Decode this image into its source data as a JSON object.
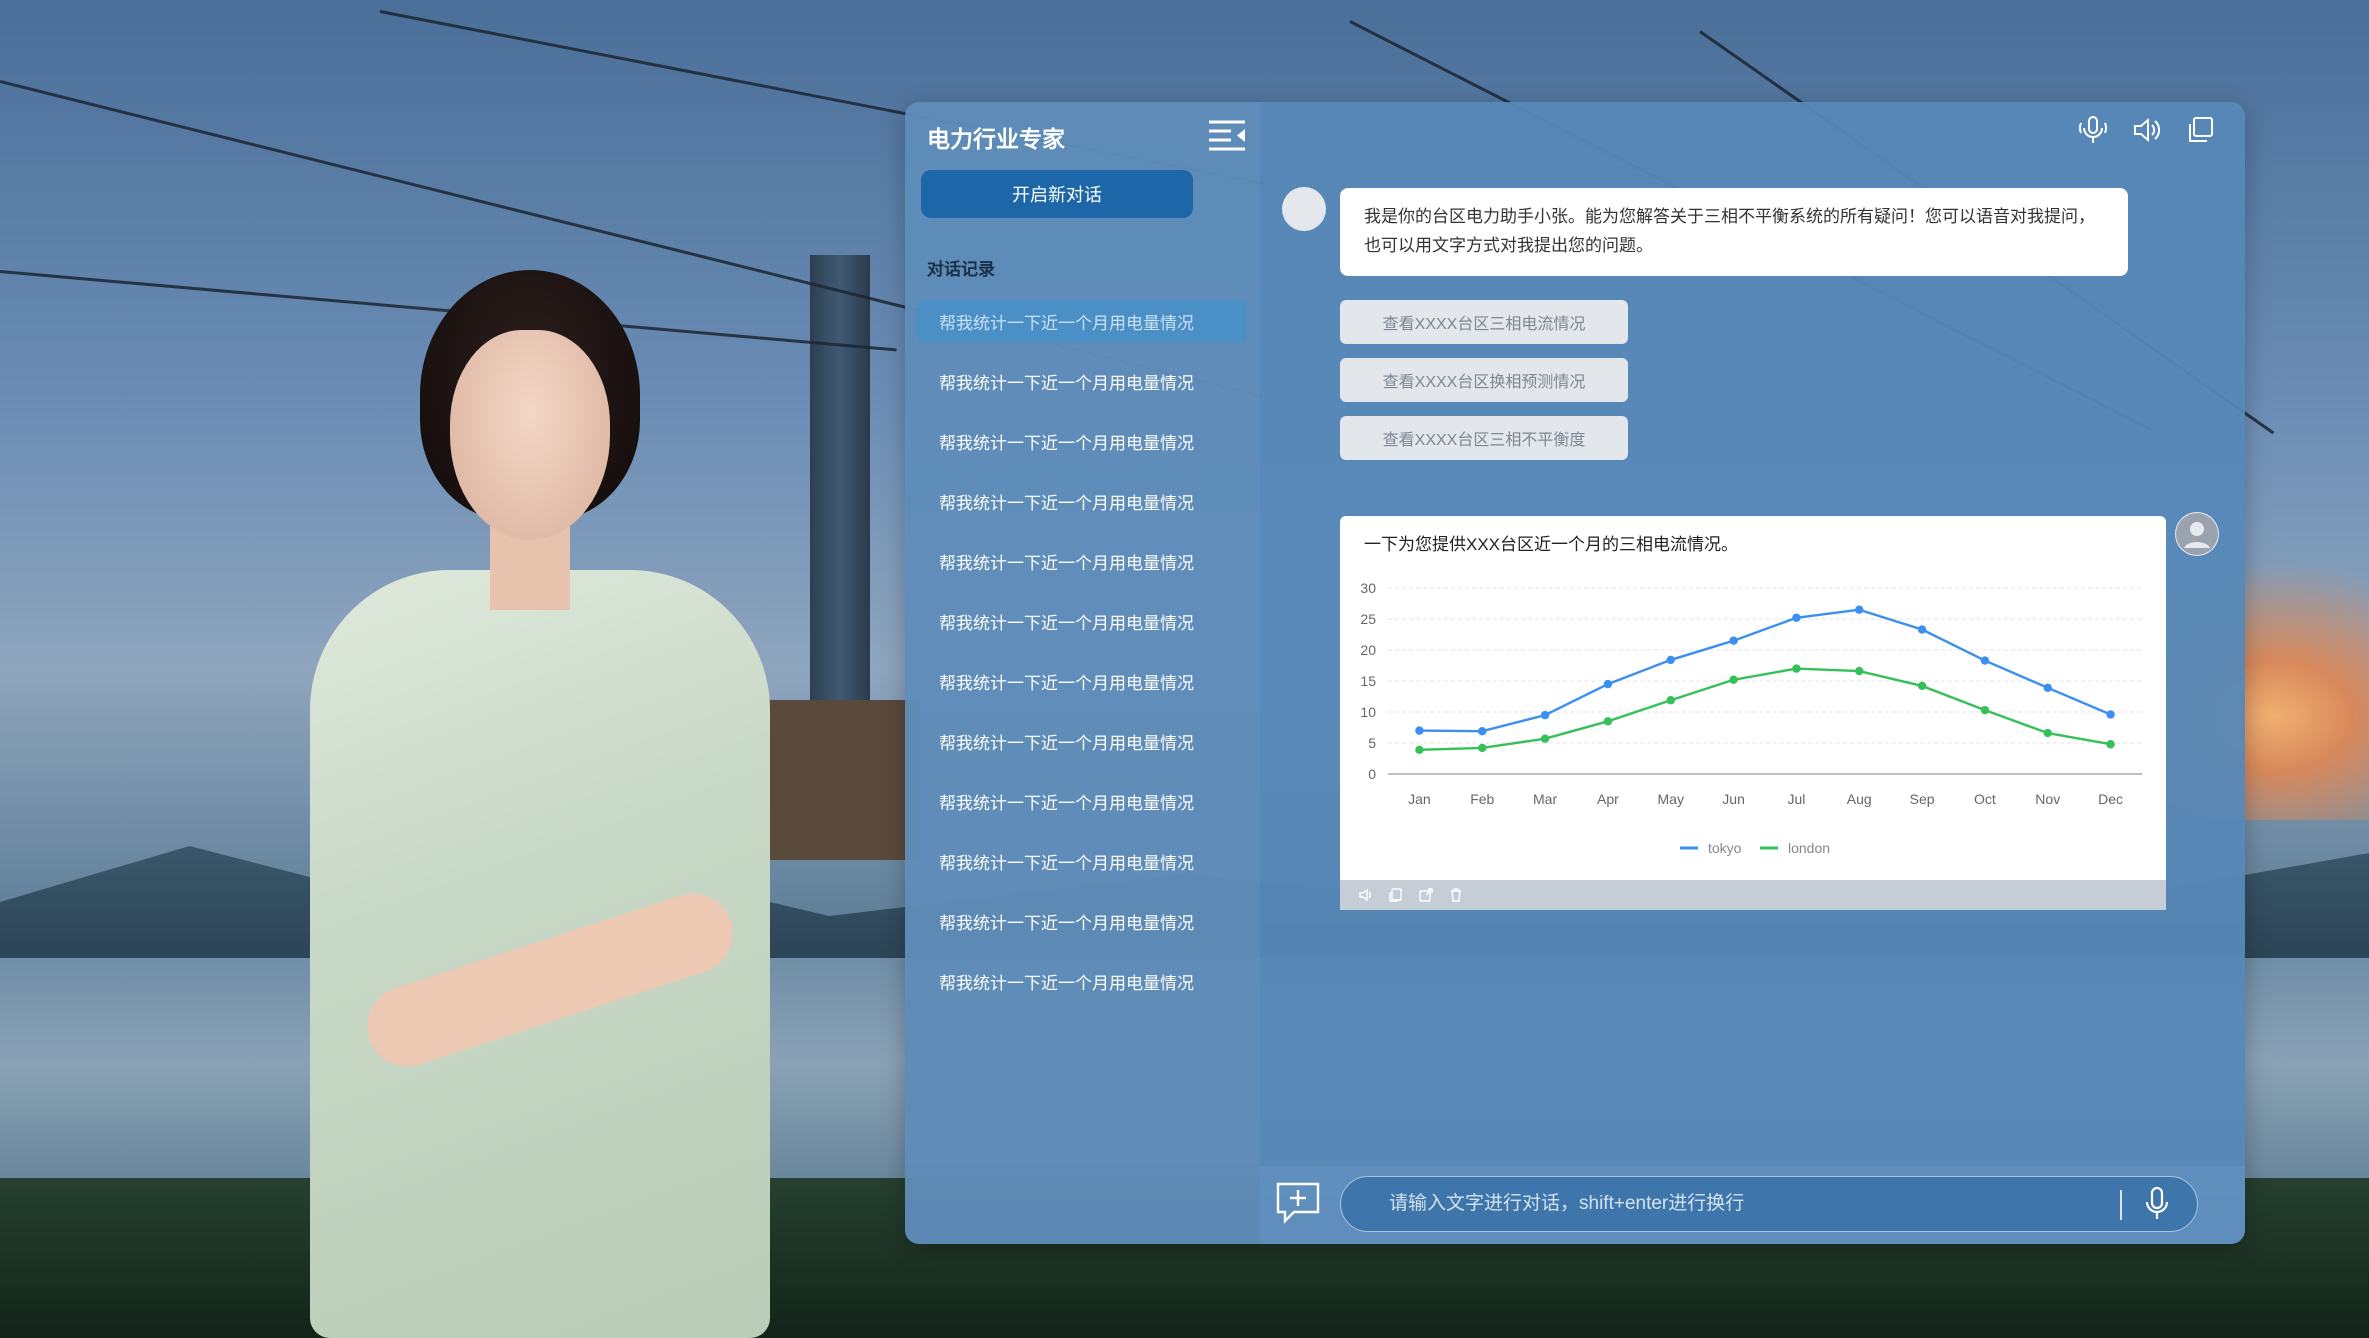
{
  "app": {
    "title": "电力行业专家",
    "new_chat_label": "开启新对话",
    "history_label": "对话记录"
  },
  "history": {
    "items": [
      {
        "label": "帮我统计一下近一个月用电量情况",
        "active": true
      },
      {
        "label": "帮我统计一下近一个月用电量情况",
        "active": false
      },
      {
        "label": "帮我统计一下近一个月用电量情况",
        "active": false
      },
      {
        "label": "帮我统计一下近一个月用电量情况",
        "active": false
      },
      {
        "label": "帮我统计一下近一个月用电量情况",
        "active": false
      },
      {
        "label": "帮我统计一下近一个月用电量情况",
        "active": false
      },
      {
        "label": "帮我统计一下近一个月用电量情况",
        "active": false
      },
      {
        "label": "帮我统计一下近一个月用电量情况",
        "active": false
      },
      {
        "label": "帮我统计一下近一个月用电量情况",
        "active": false
      },
      {
        "label": "帮我统计一下近一个月用电量情况",
        "active": false
      },
      {
        "label": "帮我统计一下近一个月用电量情况",
        "active": false
      },
      {
        "label": "帮我统计一下近一个月用电量情况",
        "active": false
      }
    ]
  },
  "toolbar": {
    "icons": [
      "microphone-icon",
      "speaker-icon",
      "window-icon"
    ]
  },
  "chat": {
    "greeting": "我是你的台区电力助手小张。能为您解答关于三相不平衡系统的所有疑问！您可以语音对我提问，也可以用文字方式对我提出您的问题。",
    "suggestions": [
      "查看XXXX台区三相电流情况",
      "查看XXXX台区换相预测情况",
      "查看XXXX台区三相不平衡度"
    ],
    "chart_caption": "一下为您提供XXX台区近一个月的三相电流情况。",
    "message_action_icons": [
      "speaker-icon",
      "copy-icon",
      "share-icon",
      "delete-icon"
    ]
  },
  "input": {
    "placeholder": "请输入文字进行对话，shift+enter进行换行"
  },
  "colors": {
    "tokyo": "#3b8ff0",
    "london": "#36c05a",
    "accent": "#1d67a8"
  },
  "chart_data": {
    "type": "line",
    "categories": [
      "Jan",
      "Feb",
      "Mar",
      "Apr",
      "May",
      "Jun",
      "Jul",
      "Aug",
      "Sep",
      "Oct",
      "Nov",
      "Dec"
    ],
    "series": [
      {
        "name": "tokyo",
        "values": [
          7.0,
          6.9,
          9.5,
          14.5,
          18.4,
          21.5,
          25.2,
          26.5,
          23.3,
          18.3,
          13.9,
          9.6
        ]
      },
      {
        "name": "london",
        "values": [
          3.9,
          4.2,
          5.7,
          8.5,
          11.9,
          15.2,
          17.0,
          16.6,
          14.2,
          10.3,
          6.6,
          4.8
        ]
      }
    ],
    "yticks": [
      0,
      5,
      10,
      15,
      20,
      25,
      30
    ],
    "ylim": [
      0,
      30
    ],
    "grid": true,
    "legend": "bottom"
  }
}
